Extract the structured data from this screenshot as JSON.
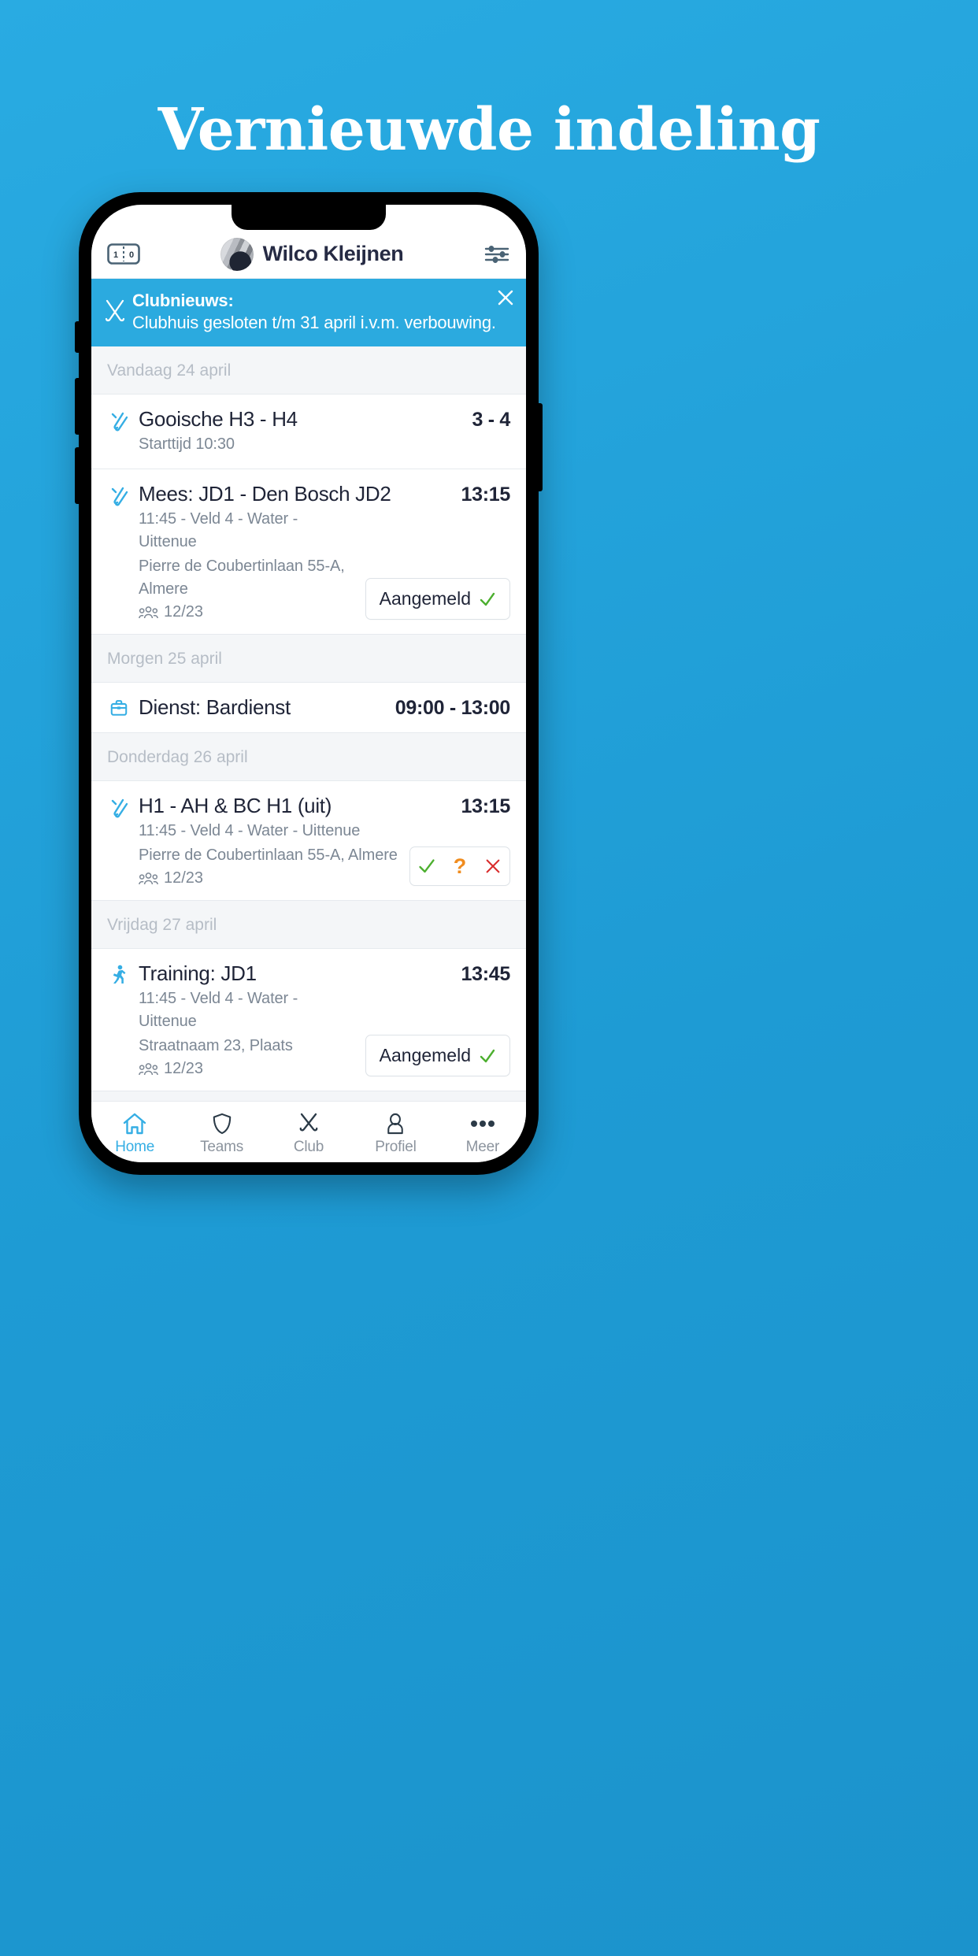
{
  "headline": "Vernieuwde indeling",
  "colors": {
    "background": "#29ABE2",
    "accent": "#35AEE4",
    "banner": "#2BAADF",
    "text_dark": "#1F2437",
    "text_muted": "#7C8794",
    "day_header": "#B6BDC6",
    "green": "#4CAF2F",
    "orange": "#F08C1E",
    "red": "#D92D2D"
  },
  "header": {
    "score_icon": "scoreboard-icon",
    "score_home": "1",
    "score_away": "0",
    "avatar": "user-avatar",
    "user_name": "Wilco Kleijnen",
    "settings_icon": "sliders-icon"
  },
  "banner": {
    "icon": "crossed-hockey-sticks-icon",
    "title": "Clubnieuws:",
    "message": "Clubhuis gesloten t/m 31 april i.v.m. verbouwing.",
    "close_icon": "close-icon"
  },
  "sections": [
    {
      "day": "Vandaag 24 april",
      "events": [
        {
          "icon": "hockey-sticks-icon",
          "title": "Gooische H3 - H4",
          "right": "3 - 4",
          "sub1": "Starttijd 10:30",
          "sub2": "",
          "count": "",
          "action": "none"
        }
      ]
    },
    {
      "day": "",
      "events": [
        {
          "icon": "hockey-sticks-icon",
          "title": "Mees: JD1 - Den Bosch JD2",
          "right": "13:15",
          "sub1": "11:45 - Veld 4 - Water - Uittenue",
          "sub2": "Pierre de Coubertinlaan 55-A, Almere",
          "count": "12/23",
          "action": "signed",
          "action_label": "Aangemeld"
        }
      ]
    },
    {
      "day": "Morgen 25 april",
      "events": [
        {
          "icon": "briefcase-icon",
          "title": "Dienst: Bardienst",
          "right": "09:00 - 13:00",
          "sub1": "",
          "sub2": "",
          "count": "",
          "action": "none"
        }
      ]
    },
    {
      "day": "Donderdag 26 april",
      "events": [
        {
          "icon": "hockey-sticks-icon",
          "title": "H1 - AH & BC H1 (uit)",
          "right": "13:15",
          "sub1": "11:45 - Veld 4 - Water - Uittenue",
          "sub2": "Pierre de Coubertinlaan 55-A, Almere",
          "count": "12/23",
          "action": "choices",
          "choice_yes": "✓",
          "choice_maybe": "?",
          "choice_no": "✕"
        }
      ]
    },
    {
      "day": "Vrijdag 27 april",
      "events": [
        {
          "icon": "running-person-icon",
          "title": "Training: JD1",
          "right": "13:45",
          "sub1": "11:45 - Veld 4 - Water - Uittenue",
          "sub2": "Straatnaam 23, Plaats",
          "count": "12/23",
          "action": "signed",
          "action_label": "Aangemeld"
        }
      ]
    }
  ],
  "tabs": [
    {
      "icon": "home-icon",
      "label": "Home",
      "active": true
    },
    {
      "icon": "shield-icon",
      "label": "Teams",
      "active": false
    },
    {
      "icon": "hockey-sticks-icon",
      "label": "Club",
      "active": false
    },
    {
      "icon": "person-icon",
      "label": "Profiel",
      "active": false
    },
    {
      "icon": "ellipsis-icon",
      "label": "Meer",
      "active": false
    }
  ]
}
